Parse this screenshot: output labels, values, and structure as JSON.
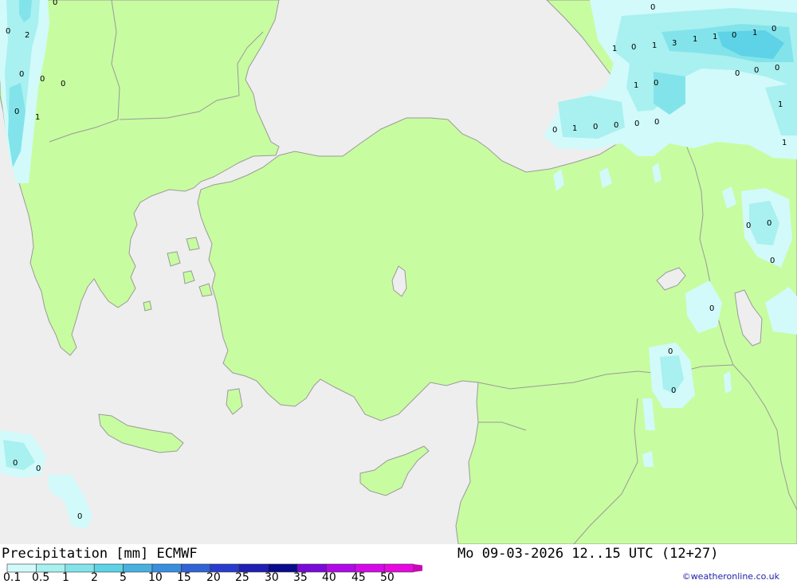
{
  "map": {
    "colors": {
      "sea": "#eeeeee",
      "land": "#c8fca0",
      "border": "#9a9a9a"
    },
    "labels": [
      "0",
      "2",
      "0",
      "0",
      "0",
      "0",
      "1",
      "0",
      "0",
      "1",
      "0",
      "1",
      "3",
      "1",
      "1",
      "0",
      "1",
      "0",
      "0",
      "0",
      "0",
      "1",
      "0",
      "1",
      "0",
      "1",
      "0",
      "0",
      "0",
      "0",
      "1",
      "0",
      "0",
      "0",
      "0",
      "0",
      "0",
      "0",
      "0"
    ]
  },
  "footer": {
    "title": "Precipitation [mm] ECMWF",
    "date_label": "Mo 09-03-2026 12..15 UTC (12+27)",
    "credit": "©weatheronline.co.uk"
  },
  "legend": {
    "ticks": [
      "0.1",
      "0.5",
      "1",
      "2",
      "5",
      "10",
      "15",
      "20",
      "25",
      "30",
      "35",
      "40",
      "45",
      "50"
    ],
    "colors": [
      "#d2fafa",
      "#a9f0f0",
      "#82e4ea",
      "#5ed2e6",
      "#48b1e0",
      "#3a8ee0",
      "#3163d6",
      "#2a3ccc",
      "#1f1fb4",
      "#0a0a8c",
      "#7a0ad8",
      "#b00ae8",
      "#d40ae8",
      "#e60ae0",
      "#c80ab4"
    ]
  }
}
